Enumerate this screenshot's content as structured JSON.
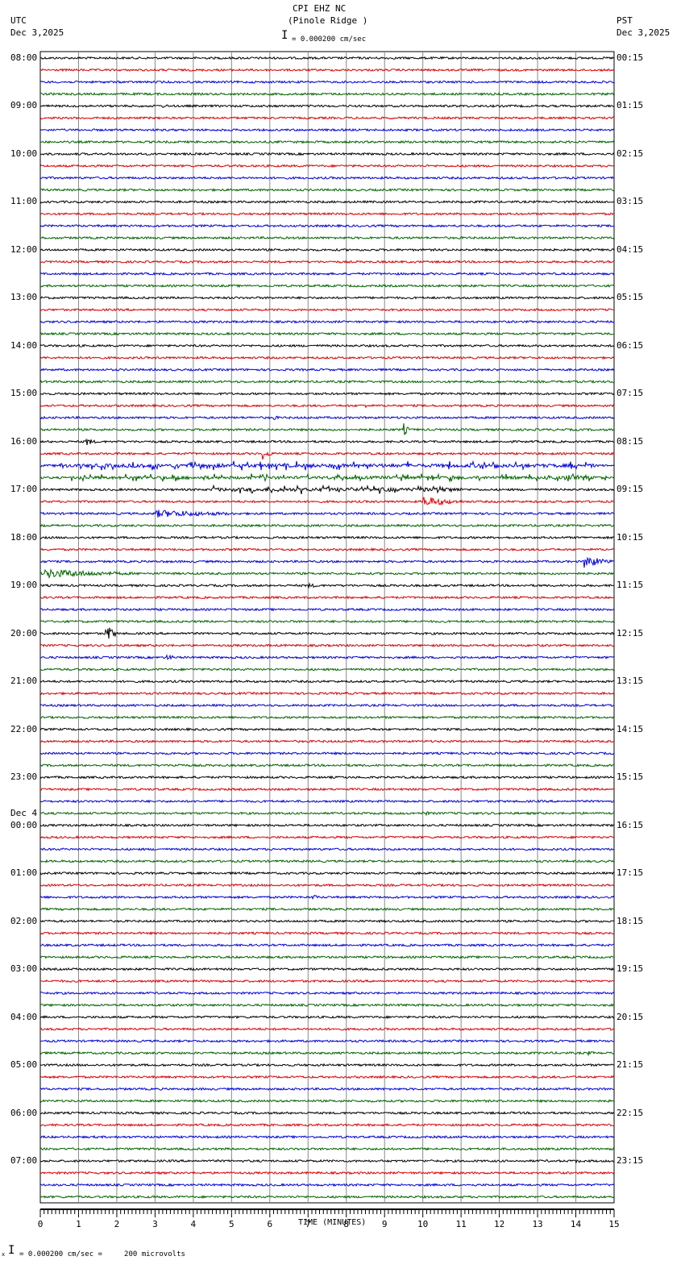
{
  "header": {
    "title": "CPI EHZ NC",
    "subtitle": "(Pinole Ridge )",
    "left_tz": "UTC",
    "left_date": "Dec 3,2025",
    "right_tz": "PST",
    "right_date": "Dec 3,2025",
    "scale_text": "= 0.000200 cm/sec"
  },
  "footer": {
    "scale_text": "= 0.000200 cm/sec =     200 microvolts",
    "mark": "x"
  },
  "chart_data": {
    "type": "line",
    "title": "CPI EHZ NC (Pinole Ridge )",
    "xlabel": "TIME (MINUTES)",
    "xlim": [
      0,
      15
    ],
    "x_ticks": [
      "0",
      "1",
      "2",
      "3",
      "4",
      "5",
      "6",
      "7",
      "8",
      "9",
      "10",
      "11",
      "12",
      "13",
      "14",
      "15"
    ],
    "traces_per_hour": 4,
    "trace_colors": [
      "#000000",
      "#dd0000",
      "#0000dd",
      "#006400"
    ],
    "grid": true,
    "left_labels": [
      "08:00",
      "09:00",
      "10:00",
      "11:00",
      "12:00",
      "13:00",
      "14:00",
      "15:00",
      "16:00",
      "17:00",
      "18:00",
      "19:00",
      "20:00",
      "21:00",
      "22:00",
      "23:00",
      "00:00",
      "01:00",
      "02:00",
      "03:00",
      "04:00",
      "05:00",
      "06:00",
      "07:00"
    ],
    "day_change_label": "Dec 4",
    "right_labels": [
      "00:15",
      "01:15",
      "02:15",
      "03:15",
      "04:15",
      "05:15",
      "06:15",
      "07:15",
      "08:15",
      "09:15",
      "10:15",
      "11:15",
      "12:15",
      "13:15",
      "14:15",
      "15:15",
      "16:15",
      "17:15",
      "18:15",
      "19:15",
      "20:15",
      "21:15",
      "22:15",
      "23:15"
    ],
    "events": [
      {
        "trace": 4,
        "minute": 3.2,
        "amp": 2,
        "dur": 1.0
      },
      {
        "trace": 21,
        "minute": 4.5,
        "amp": 2,
        "dur": 0.8
      },
      {
        "trace": 29,
        "minute": 8.5,
        "amp": 3,
        "dur": 0.3
      },
      {
        "trace": 30,
        "minute": 6.1,
        "amp": 3,
        "dur": 0.3
      },
      {
        "trace": 31,
        "minute": 9.5,
        "amp": 8,
        "dur": 0.2
      },
      {
        "trace": 32,
        "minute": 1.2,
        "amp": 6,
        "dur": 0.3
      },
      {
        "trace": 33,
        "minute": 5.8,
        "amp": 8,
        "dur": 0.3
      },
      {
        "trace": 34,
        "minute": 0.5,
        "amp": 6,
        "dur": 14.0
      },
      {
        "trace": 35,
        "minute": 0.8,
        "amp": 5,
        "dur": 14.0
      },
      {
        "trace": 36,
        "minute": 4.5,
        "amp": 6,
        "dur": 6.5
      },
      {
        "trace": 37,
        "minute": 10.0,
        "amp": 7,
        "dur": 1.2
      },
      {
        "trace": 38,
        "minute": 3.0,
        "amp": 5,
        "dur": 3.0
      },
      {
        "trace": 42,
        "minute": 14.2,
        "amp": 9,
        "dur": 0.8
      },
      {
        "trace": 43,
        "minute": 0.1,
        "amp": 6,
        "dur": 2.8
      },
      {
        "trace": 44,
        "minute": 7.0,
        "amp": 3,
        "dur": 0.6
      },
      {
        "trace": 48,
        "minute": 1.7,
        "amp": 14,
        "dur": 0.3
      },
      {
        "trace": 50,
        "minute": 3.3,
        "amp": 4,
        "dur": 0.4
      },
      {
        "trace": 59,
        "minute": 3.5,
        "amp": 3,
        "dur": 0.6
      },
      {
        "trace": 63,
        "minute": 10.0,
        "amp": 3,
        "dur": 0.5
      },
      {
        "trace": 70,
        "minute": 7.1,
        "amp": 4,
        "dur": 0.3
      },
      {
        "trace": 79,
        "minute": 9.4,
        "amp": 3,
        "dur": 0.3
      },
      {
        "trace": 83,
        "minute": 14.3,
        "amp": 3,
        "dur": 0.4
      },
      {
        "trace": 92,
        "minute": 14.0,
        "amp": 3,
        "dur": 0.3
      }
    ]
  }
}
